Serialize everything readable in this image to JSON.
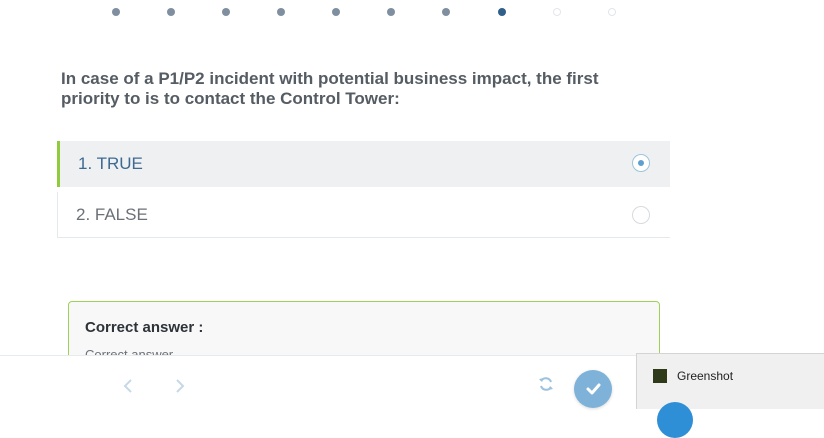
{
  "progress": {
    "total": 10,
    "current": 8
  },
  "question": {
    "text": "In case of a P1/P2 incident with potential business impact, the first priority to is to contact the Control Tower:"
  },
  "options": [
    {
      "label": "1. TRUE",
      "selected": true
    },
    {
      "label": "2. FALSE",
      "selected": false
    }
  ],
  "answer": {
    "title": "Correct answer :",
    "text": "Correct answer"
  },
  "toolbar": {
    "prev_icon": "chevron-left-icon",
    "next_icon": "chevron-right-icon",
    "refresh_icon": "refresh-icon",
    "submit_icon": "check-icon"
  },
  "notification": {
    "app": "Greenshot"
  },
  "colors": {
    "accent": "#8fcb3b",
    "primary": "#2f5f8a",
    "button": "#7fb2d8"
  }
}
